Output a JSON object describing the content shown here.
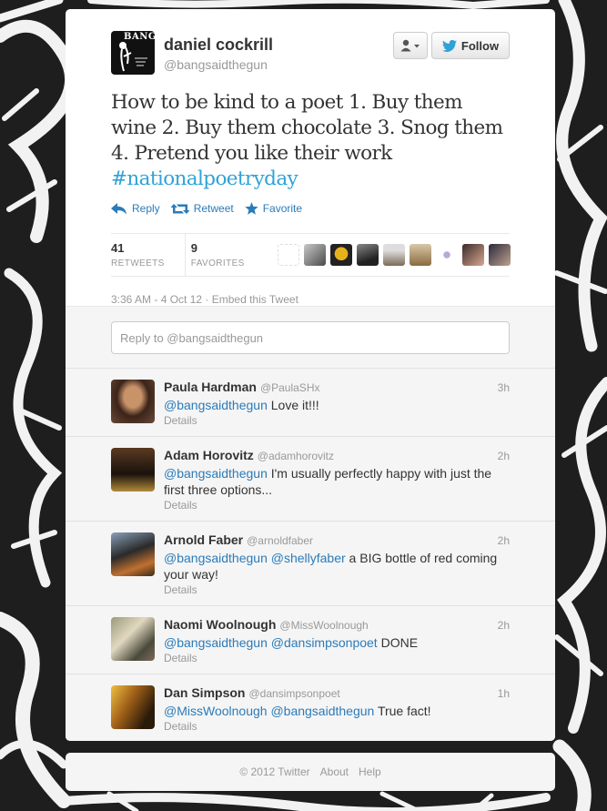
{
  "author": {
    "name": "daniel cockrill",
    "handle": "@bangsaidthegun",
    "avatar_text": "BANG"
  },
  "buttons": {
    "follow_label": "Follow"
  },
  "tweet": {
    "text": "How to be kind to a poet 1. Buy them wine 2. Buy them chocolate 3. Snog them 4. Pretend you like their work ",
    "hashtag": "#nationalpoetryday",
    "timestamp": "3:36 AM - 4 Oct 12",
    "separator": " · ",
    "embed_label": "Embed this Tweet"
  },
  "actions": {
    "reply": "Reply",
    "retweet": "Retweet",
    "favorite": "Favorite"
  },
  "stats": {
    "retweets_count": "41",
    "retweets_label": "RETWEETS",
    "favorites_count": "9",
    "favorites_label": "FAVORITES"
  },
  "reply_box": {
    "placeholder": "Reply to @bangsaidthegun"
  },
  "replies": [
    {
      "name": "Paula Hardman",
      "handle": "@PaulaSHx",
      "time": "3h",
      "mentions": "@bangsaidthegun",
      "text": " Love it!!!",
      "details": "Details"
    },
    {
      "name": "Adam Horovitz",
      "handle": "@adamhorovitz",
      "time": "2h",
      "mentions": "@bangsaidthegun",
      "text": " I'm usually perfectly happy with just the first three options...",
      "details": "Details"
    },
    {
      "name": "Arnold Faber",
      "handle": "@arnoldfaber",
      "time": "2h",
      "mentions": "@bangsaidthegun @shellyfaber",
      "text": " a BIG bottle of red coming your way!",
      "details": "Details"
    },
    {
      "name": "Naomi Woolnough",
      "handle": "@MissWoolnough",
      "time": "2h",
      "mentions": "@bangsaidthegun @dansimpsonpoet",
      "text": " DONE",
      "details": "Details"
    },
    {
      "name": "Dan Simpson",
      "handle": "@dansimpsonpoet",
      "time": "1h",
      "mentions": "@MissWoolnough @bangsaidthegun",
      "text": " True fact!",
      "details": "Details"
    }
  ],
  "footer": {
    "copyright": "© 2012 Twitter",
    "about": "About",
    "help": "Help"
  },
  "colors": {
    "link": "#2b7bb9",
    "hashtag": "#2fa2d6",
    "muted": "#999999"
  }
}
